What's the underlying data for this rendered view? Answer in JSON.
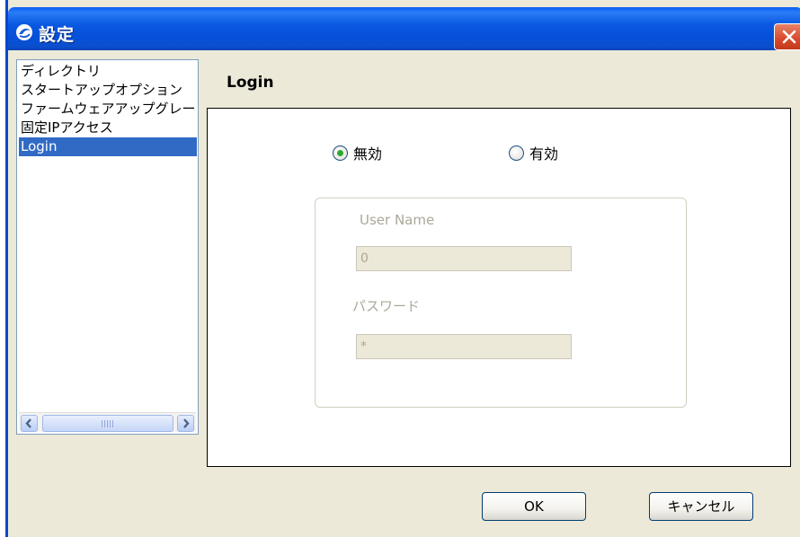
{
  "window": {
    "title": "設定",
    "icon": "app-logo-icon",
    "close_icon": "close-icon"
  },
  "sidebar": {
    "items": [
      {
        "label": "ディレクトリ",
        "selected": false
      },
      {
        "label": "スタートアップオプション",
        "selected": false
      },
      {
        "label": "ファームウェアアップグレード",
        "selected": false
      },
      {
        "label": "固定IPアクセス",
        "selected": false
      },
      {
        "label": "Login",
        "selected": true
      }
    ],
    "scroll_thumb_grip": "III"
  },
  "panel": {
    "title": "Login",
    "login_mode": {
      "options": [
        {
          "label": "無効",
          "checked": true
        },
        {
          "label": "有効",
          "checked": false
        }
      ]
    },
    "user_name": {
      "label": "User Name",
      "value": "0",
      "disabled": true
    },
    "password": {
      "label": "パスワード",
      "value": "*",
      "disabled": true
    }
  },
  "buttons": {
    "ok": "OK",
    "cancel": "キャンセル"
  },
  "colors": {
    "titlebar": "#0550d8",
    "selection": "#316ac5",
    "dialog_bg": "#ece9d8",
    "radio_dot": "#2fa82f",
    "close_button": "#d9482a"
  }
}
